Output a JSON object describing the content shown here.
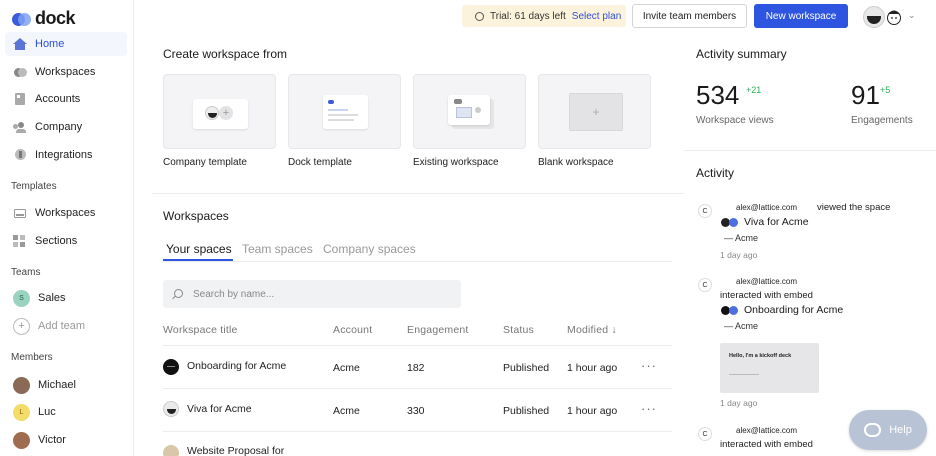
{
  "brand": {
    "name": "dock"
  },
  "sidebar": {
    "items": [
      {
        "label": "Home"
      },
      {
        "label": "Workspaces"
      },
      {
        "label": "Accounts"
      },
      {
        "label": "Company"
      },
      {
        "label": "Integrations"
      }
    ],
    "templates_label": "Templates",
    "template_items": [
      {
        "label": "Workspaces"
      },
      {
        "label": "Sections"
      }
    ],
    "teams_label": "Teams",
    "teams": [
      {
        "label": "Sales",
        "initial": "S"
      },
      {
        "label": "Add team"
      }
    ],
    "members_label": "Members",
    "members": [
      {
        "label": "Michael"
      },
      {
        "label": "Luc",
        "initial": "L"
      },
      {
        "label": "Victor"
      }
    ]
  },
  "header": {
    "trial_text": "Trial: 61 days left",
    "trial_link": "Select plan",
    "invite_label": "Invite team members",
    "new_workspace_label": "New workspace"
  },
  "create": {
    "title": "Create workspace from",
    "cards": [
      {
        "label": "Company template"
      },
      {
        "label": "Dock template"
      },
      {
        "label": "Existing workspace"
      },
      {
        "label": "Blank workspace"
      }
    ]
  },
  "workspaces": {
    "title": "Workspaces",
    "tabs": [
      {
        "label": "Your spaces"
      },
      {
        "label": "Team spaces"
      },
      {
        "label": "Company spaces"
      }
    ],
    "search_placeholder": "Search by name...",
    "columns": [
      "Workspace title",
      "Account",
      "Engagement",
      "Status",
      "Modified"
    ],
    "sort_arrow": "↓",
    "rows": [
      {
        "title": "Onboarding for Acme",
        "account": "Acme",
        "engagement": "182",
        "status": "Published",
        "modified": "1 hour ago"
      },
      {
        "title": "Viva for Acme",
        "account": "Acme",
        "engagement": "330",
        "status": "Published",
        "modified": "1 hour ago"
      },
      {
        "title": "Website Proposal for"
      }
    ],
    "more_label": "···"
  },
  "activity_summary": {
    "title": "Activity summary",
    "views": {
      "value": "534",
      "delta": "+21",
      "label": "Workspace views"
    },
    "engagements": {
      "value": "91",
      "delta": "+5",
      "label": "Engagements"
    }
  },
  "activity": {
    "title": "Activity",
    "items": [
      {
        "initial": "C",
        "email": "alex@lattice.com",
        "action": "viewed the space",
        "workspace": "Viva for Acme",
        "account": "— Acme",
        "time": "1 day ago"
      },
      {
        "initial": "C",
        "email": "alex@lattice.com",
        "action": "interacted with embed",
        "workspace": "Onboarding for Acme",
        "account": "— Acme",
        "embed_title": "Hello, I'm a kickoff deck",
        "time": "1 day ago"
      },
      {
        "initial": "C",
        "email": "alex@lattice.com",
        "action": "interacted with embed"
      }
    ]
  },
  "help": {
    "label": "Help"
  },
  "colors": {
    "accent": "#2d55e0",
    "delta_green": "#2eaa5a",
    "trial_bg": "#fdf3dc"
  }
}
